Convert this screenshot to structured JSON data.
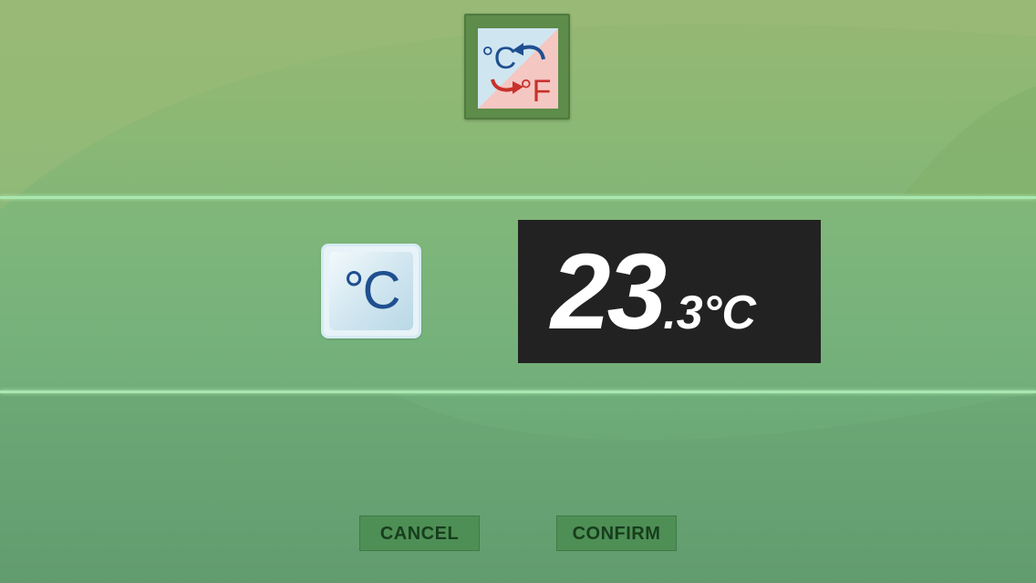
{
  "app_icon": {
    "name": "celsius-fahrenheit-convert-icon",
    "celsius_glyph": "°C",
    "fahrenheit_glyph": "°F"
  },
  "unit_selector": {
    "label": "°C"
  },
  "display": {
    "integer_part": "23",
    "fraction_part": ".3°C"
  },
  "buttons": {
    "cancel_label": "CANCEL",
    "confirm_label": "CONFIRM"
  },
  "colors": {
    "celsius_blue": "#1f4f8f",
    "fahrenheit_red": "#c8322a",
    "display_bg": "#222222"
  }
}
